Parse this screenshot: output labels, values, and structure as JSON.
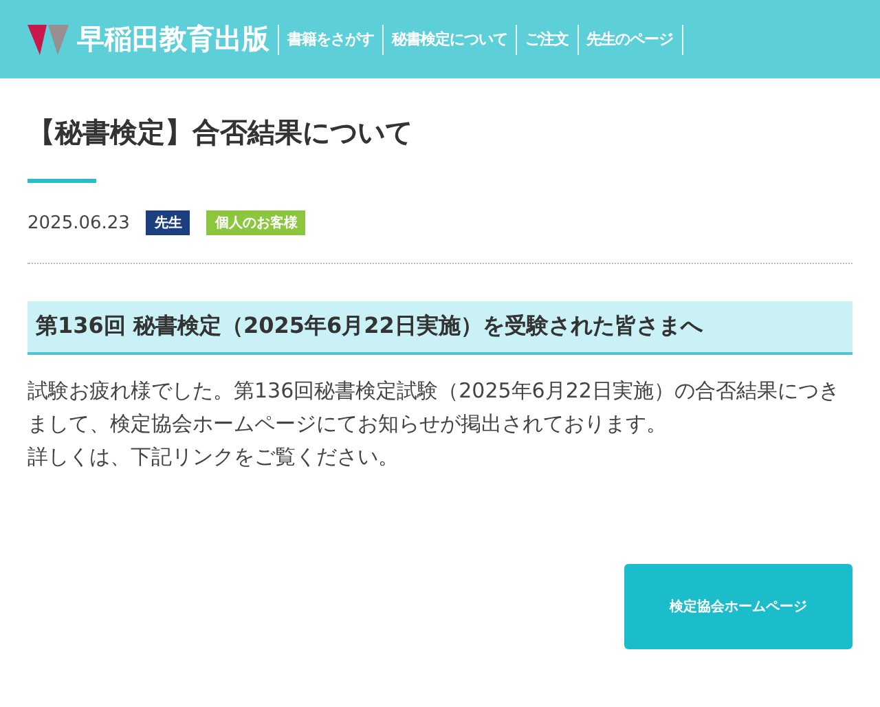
{
  "header": {
    "brand": "早稲田教育出版",
    "nav": [
      {
        "label": "書籍をさがす"
      },
      {
        "label": "秘書検定について"
      },
      {
        "label": "ご注文"
      },
      {
        "label": "先生のページ"
      }
    ]
  },
  "article": {
    "title": "【秘書検定】合否結果について",
    "date": "2025.06.23",
    "tags": [
      {
        "label": "先生",
        "color": "#1b3f7f"
      },
      {
        "label": "個人のお客様",
        "color": "#8cc63e"
      }
    ],
    "heading": "第136回 秘書検定（2025年6月22日実施）を受験された皆さまへ",
    "paragraphs": [
      "試験お疲れ様でした。第136回秘書検定試験（2025年6月22日実施）の合否結果につきまして、検定協会ホームページにてお知らせが掲出されております。",
      "詳しくは、下記リンクをご覧ください。"
    ],
    "button": "検定協会ホームページ"
  }
}
